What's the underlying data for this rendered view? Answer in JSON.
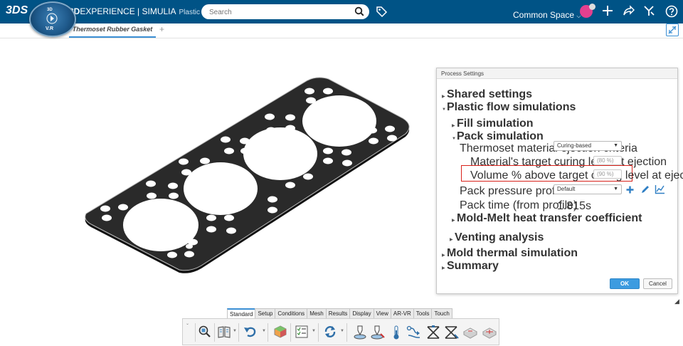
{
  "header": {
    "logo": "3DS",
    "compass": {
      "top": "3D",
      "bottom": "V.R"
    },
    "brand_bold": "3D",
    "brand_rest": "EXPERIENCE | SIMULIA",
    "app_name": "Plastic Inj...",
    "search_placeholder": "Search",
    "space": "Common Space",
    "colors": {
      "bar": "#005386",
      "avatar": "#e3408f"
    }
  },
  "tab": {
    "label": "Thermoset Rubber Gasket",
    "add": "+"
  },
  "panel": {
    "title": "Process Settings",
    "shared_settings": "Shared settings",
    "plastic_flow": "Plastic flow simulations",
    "fill_sim": "Fill simulation",
    "pack_sim": "Pack simulation",
    "ejection_criteria_label": "Thermoset material ejection criteria",
    "ejection_criteria_value": "Curing-based",
    "target_curing_label": "Material's target curing level at ejection",
    "target_curing_value": "(80 %)",
    "volume_label": "Volume % above target curing level at ejection",
    "volume_value": "(90 %)",
    "pack_pressure_label": "Pack pressure profile",
    "pack_pressure_value": "Default",
    "pack_time_label": "Pack time (from profile)",
    "pack_time_value": "1.815s",
    "heat_transfer": "Mold-Melt heat transfer coefficient",
    "venting": "Venting analysis",
    "mold_thermal": "Mold thermal simulation",
    "summary": "Summary",
    "ok": "OK",
    "cancel": "Cancel"
  },
  "action_bar": {
    "tabs": [
      "Standard",
      "Setup",
      "Conditions",
      "Mesh",
      "Results",
      "Display",
      "View",
      "AR-VR",
      "Tools",
      "Touch"
    ],
    "active_tab": "Standard",
    "tools": [
      "zoom-fit-icon",
      "book-icon",
      "undo-icon",
      "material-icon",
      "checklist-icon",
      "update-icon",
      "injection-location-icon",
      "probe-icon",
      "thermometer-icon",
      "flow-icon",
      "valve-icon",
      "valve-gate-icon",
      "mold-icon",
      "mold-section-icon"
    ]
  }
}
